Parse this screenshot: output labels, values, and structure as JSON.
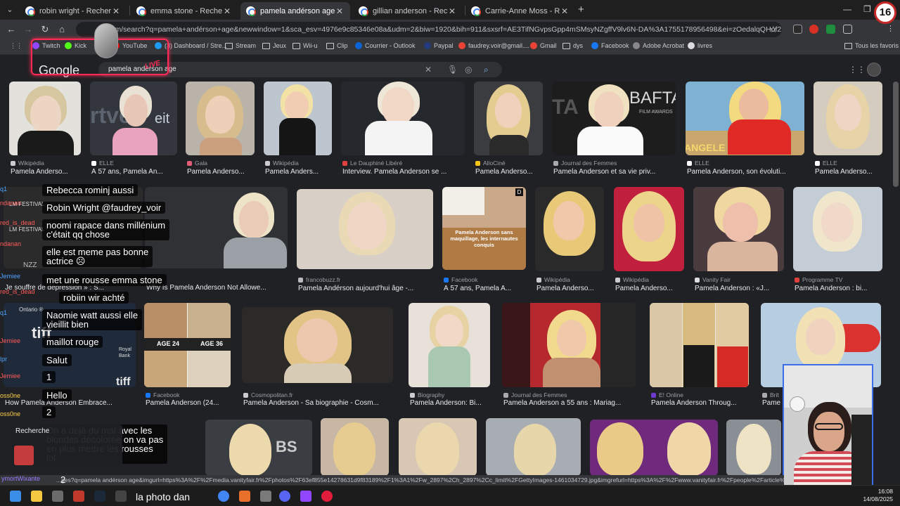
{
  "tabs": [
    {
      "title": "robin wright - Recherche Google",
      "active": false
    },
    {
      "title": "emma stone - Recherche Google",
      "active": false
    },
    {
      "title": "pamela andérson age - Recherche",
      "active": true
    },
    {
      "title": "gillian anderson - Recherche Go",
      "active": false
    },
    {
      "title": "Carrie-Anne Moss - Recherche",
      "active": false
    }
  ],
  "new_tab_label": "+",
  "age_badge": "16",
  "address_bar": {
    "url": "…m/search?q=pamela+andérson+age&newwindow=1&sca_esv=4976e9c85346e08a&udm=2&biw=1920&bih=911&sxsrf=AE3TifNGvpsGpp4mSMsyNZgffV9lv6N-DA%3A1755178956498&ei=zOedalqQHof2kdUP9c6OqAs&…"
  },
  "bookmarks": [
    "Twitch",
    "Kick",
    "YouTube",
    "(3) Dashboard / Stre...",
    "Stream",
    "Jeux",
    "Wii-u",
    "Clip",
    "Courrier - Outlook",
    "Paypal",
    "faudrey.voir@gmail....",
    "Gmail",
    "dys",
    "Facebook",
    "Adobe Acrobat",
    "livres"
  ],
  "bookmarks_right": "Tous les favoris",
  "google": {
    "logo": "Google",
    "query": "pamela andérson age"
  },
  "row1": [
    {
      "source": "Wikipédia",
      "caption": "Pamela Anderso..."
    },
    {
      "source": "ELLE",
      "caption": "À 57 ans, Pamela An..."
    },
    {
      "source": "Gala",
      "caption": "Pamela Anderso..."
    },
    {
      "source": "Wikipédia",
      "caption": "Pamela Anders..."
    },
    {
      "source": "Le Dauphiné Libéré",
      "caption": "Interview. Pamela Anderson se ..."
    },
    {
      "source": "AlloCiné",
      "caption": "Pamela Anderso..."
    },
    {
      "source": "Journal des Femmes",
      "caption": "Pamela Anderson et sa vie priv..."
    },
    {
      "source": "ELLE",
      "caption": "Pamela Anderson, son évoluti..."
    },
    {
      "source": "ELLE",
      "caption": "Pamela Anderso..."
    }
  ],
  "row2": [
    {
      "source": "",
      "caption": "Je souffre de dépression » : S..."
    },
    {
      "source": "",
      "caption": "Why Is Pamela Anderson Not Allowe..."
    },
    {
      "source": "francobuzz.fr",
      "caption": "Pamela Andérson aujourd'hui âge -..."
    },
    {
      "source": "Facebook",
      "caption": "À 57 ans, Pamela A..."
    },
    {
      "source": "Wikipédia",
      "caption": "Pamela Anderso..."
    },
    {
      "source": "Wikipédia",
      "caption": "Pamela Anderso..."
    },
    {
      "source": "Vanity Fair",
      "caption": "Pamela Anderson : «J..."
    },
    {
      "source": "Programme TV",
      "caption": "Pamela Anderson : bi..."
    }
  ],
  "row2_inset_text": "Pamela Anderson sans maquillage, les internautes conquis",
  "row3": [
    {
      "source": "",
      "caption": "How Pamela Anderson Embrace..."
    },
    {
      "source": "Facebook",
      "caption": "Pamela Anderson (24..."
    },
    {
      "source": "Cosmopolitan.fr",
      "caption": "Pamela Anderson - Sa biographie - Cosm..."
    },
    {
      "source": "Biography",
      "caption": "Pamela Anderson: Bi..."
    },
    {
      "source": "Journal des Femmes",
      "caption": "Pamela Anderson a 55 ans : Mariag..."
    },
    {
      "source": "E! Online",
      "caption": "Pamela Anderson Throug..."
    },
    {
      "source": "Brit",
      "caption": "Pame"
    }
  ],
  "row3_labels": {
    "age_24": "AGE 24",
    "age_36": "AGE 36"
  },
  "chat_names": [
    {
      "text": "q1",
      "color": "#4fa3ff"
    },
    {
      "text": "ndanan",
      "color": "#ff5b5b"
    },
    {
      "text": "red_is_dead",
      "color": "#ff5b5b"
    },
    {
      "text": "ndanan",
      "color": "#ff5b5b"
    },
    {
      "text": "Jemiee",
      "color": "#4fa3ff"
    },
    {
      "text": "red_is_dead",
      "color": "#ff5b5b"
    },
    {
      "text": "q1",
      "color": "#4fa3ff"
    },
    {
      "text": "Jemiee",
      "color": "#ff5b5b"
    },
    {
      "text": "lpr",
      "color": "#4fa3ff"
    },
    {
      "text": "Jemiee",
      "color": "#ff5b5b"
    },
    {
      "text": "oss0ne",
      "color": "#ffd04a"
    },
    {
      "text": "oss0ne",
      "color": "#ffd04a"
    }
  ],
  "chat_messages": [
    "Rebecca rominj aussi",
    "Robin Wright @faudrey_voir",
    "noomi rapace dans millénium\nc'était qq chose",
    "elle est meme pas bonne\nactrice ☹",
    "met une rousse emma stone",
    "robiin wir achté",
    "Naomie watt aussi elle\nvieillit bien",
    "maillot rouge",
    "Salut",
    "1",
    "Hello",
    "2",
    "On a déjà du mal avec les\nblondes décolorée on va pas\nen plus mettre les rousses\nlol"
  ],
  "bg_texts": {
    "lm_festival": "LM FESTIVAL",
    "nzz": "NZZ",
    "ontario": "Ontario ®",
    "tiff": "tiff",
    "royal_bank": "Royal Bank",
    "bafta": "BAFTA",
    "film_awards": "FILM AWARDS",
    "angele": "ANGELE"
  },
  "recherche_panel_title": "Recherche",
  "viewer_tag": "ymortWixante",
  "bottom_count": "2",
  "status_url": "...ges?q=pamela andérson age&imgurl=https%3A%2F%2Fmedia.vanityfair.fr%2Fphotos%2F63ef855e14278631d9f83189%2F1%3A1%2Fw_2897%2Ch_2897%2Cc_limit%2FGettyImages-1461034729.jpg&imgrefurl=https%3A%2F%2Fwww.vanityfair.fr%2Fpeople%2Farticle%2Fpamela-anders...",
  "taskbar_text": "la photo dan",
  "clock": {
    "time": "16:08",
    "date": "14/08/2025"
  }
}
